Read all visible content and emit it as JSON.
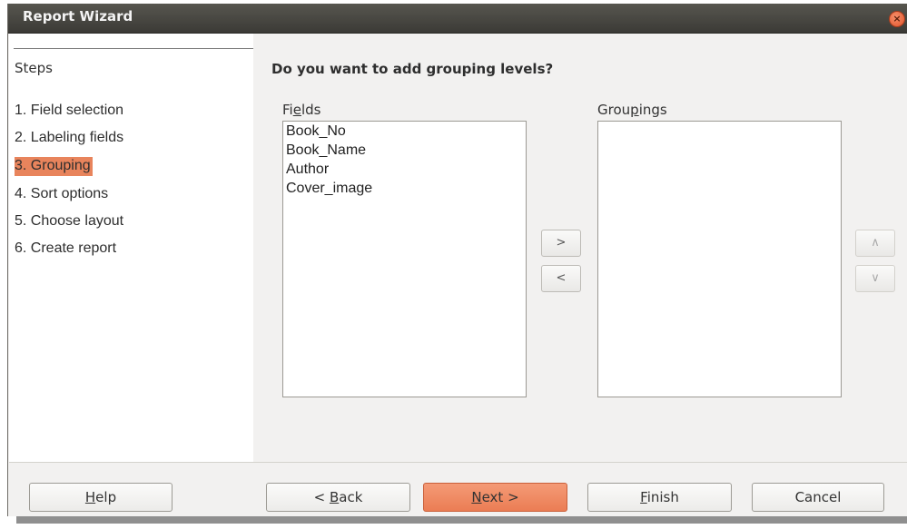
{
  "window": {
    "title": "Report Wizard",
    "close_glyph": "×"
  },
  "steps": {
    "heading": "Steps",
    "items": [
      {
        "label": "1. Field selection",
        "active": false
      },
      {
        "label": "2. Labeling fields",
        "active": false
      },
      {
        "label": "3. Grouping",
        "active": true
      },
      {
        "label": "4. Sort options",
        "active": false
      },
      {
        "label": "5. Choose layout",
        "active": false
      },
      {
        "label": "6. Create report",
        "active": false
      }
    ]
  },
  "main": {
    "question": "Do you want to add grouping levels?",
    "fields_label_pre": "Fi",
    "fields_label_mnemonic": "e",
    "fields_label_post": "lds",
    "fields": [
      "Book_No",
      "Book_Name",
      "Author",
      "Cover_image"
    ],
    "groupings_label_pre": "Grou",
    "groupings_label_mnemonic": "p",
    "groupings_label_post": "ings",
    "groupings": [],
    "add_glyph": ">",
    "remove_glyph": "<",
    "up_glyph": "∧",
    "down_glyph": "∨"
  },
  "footer": {
    "help_mnemonic": "H",
    "help_rest": "elp",
    "back_pre": "< ",
    "back_mnemonic": "B",
    "back_rest": "ack",
    "next_mnemonic": "N",
    "next_rest": "ext >",
    "finish_mnemonic": "F",
    "finish_rest": "inish",
    "cancel_label": "Cancel"
  },
  "colors": {
    "accent": "#eb7d54",
    "titlebar": "#3c3b37"
  },
  "icons": {
    "close": "close-icon",
    "add": "chevron-right-icon",
    "remove": "chevron-left-icon",
    "up": "chevron-up-icon",
    "down": "chevron-down-icon"
  }
}
